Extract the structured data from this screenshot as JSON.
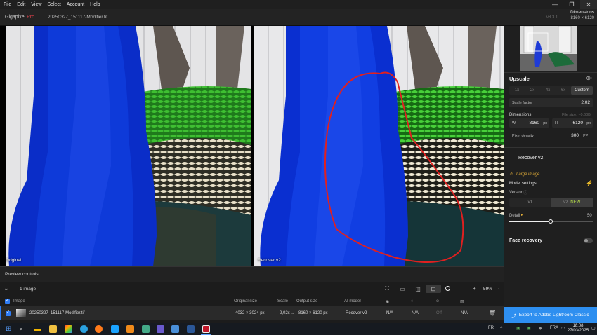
{
  "menu": [
    "File",
    "Edit",
    "View",
    "Select",
    "Account",
    "Help"
  ],
  "app": {
    "brand_name": "Gigapixel",
    "brand_edition": "Pro",
    "filename": "20250327_151117-Modifier.tif",
    "version": "v8.3.1"
  },
  "dimensions": {
    "label": "Dimensions",
    "value": "8160 × 6120"
  },
  "viewer": {
    "left_label": "Original",
    "right_label": "Recover v2"
  },
  "preview_controls": {
    "label": "Preview controls"
  },
  "toolbar": {
    "count": "1 image",
    "zoom": "59%"
  },
  "table": {
    "headers": {
      "image": "Image",
      "original_size": "Original size",
      "scale": "Scale",
      "output_size": "Output size",
      "ai_model": "AI model"
    },
    "row": {
      "name": "20250327_151117-Modifier.tif",
      "original_size": "4032 × 3024 px",
      "scale": "2,02x",
      "arrow": "→",
      "output_size": "8160 × 6120 px",
      "ai_model": "Recover v2",
      "c1": "N/A",
      "c2": "N/A",
      "c3": "Off",
      "c4": "N/A"
    }
  },
  "sidebar": {
    "upscale_title": "Upscale",
    "scale_options": [
      "1x",
      "2x",
      "4x",
      "6x",
      "Custom"
    ],
    "scale_factor_label": "Scale factor",
    "scale_factor_value": "2,02",
    "dimensions_title": "Dimensions",
    "file_size": "File size: ~0,60B",
    "w_label": "W",
    "w_value": "8160",
    "h_label": "H",
    "h_value": "6120",
    "unit": "px",
    "pixel_density_label": "Pixel density",
    "pixel_density_value": "300",
    "ppi_label": "PPI",
    "model_title": "Recover v2",
    "warning": "Large image",
    "model_settings": "Model settings",
    "version_label": "Version",
    "version_v1": "v1",
    "version_v2": "v2",
    "version_new": "NEW",
    "detail_label": "Detail",
    "detail_value": "50",
    "detail_level": 0.5,
    "face_recovery": "Face recovery",
    "face_recovery_on": false,
    "export_label": "Export to Adobe Lightroom Classic"
  },
  "taskbar": {
    "lang": "FR",
    "tray_lang": "FRA",
    "time": "18:08",
    "date": "27/03/2025"
  },
  "colors": {
    "accent": "#2e8ff0",
    "brand_red": "#e0424b",
    "annotation": "#e02020",
    "new_badge": "#b8e04a"
  }
}
